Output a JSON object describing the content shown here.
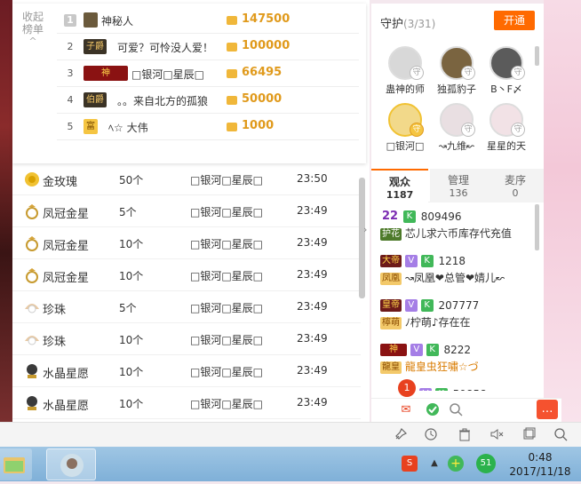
{
  "ranking": {
    "collapse_label": "收起榜单",
    "rows": [
      {
        "rank": "1",
        "badge": "",
        "name": "神秘人",
        "amount": "147500"
      },
      {
        "rank": "2",
        "badge": "子爵",
        "name": "可爱？可怜没人爱！",
        "amount": "100000"
      },
      {
        "rank": "3",
        "badge": "神",
        "name": "□银河□星辰□",
        "amount": "66495"
      },
      {
        "rank": "4",
        "badge": "伯爵",
        "name": "。。来自北方的孤狼",
        "amount": "50000"
      },
      {
        "rank": "5",
        "badge": "富",
        "name": "ﾍ☆ 大伟",
        "amount": "1000"
      }
    ]
  },
  "gifts": [
    {
      "name": "金玫瑰",
      "count": "50个",
      "sender": "□银河□星辰□",
      "time": "23:50"
    },
    {
      "name": "凤冠金星",
      "count": "5个",
      "sender": "□银河□星辰□",
      "time": "23:49"
    },
    {
      "name": "凤冠金星",
      "count": "10个",
      "sender": "□银河□星辰□",
      "time": "23:49"
    },
    {
      "name": "凤冠金星",
      "count": "10个",
      "sender": "□银河□星辰□",
      "time": "23:49"
    },
    {
      "name": "珍珠",
      "count": "5个",
      "sender": "□银河□星辰□",
      "time": "23:49"
    },
    {
      "name": "珍珠",
      "count": "10个",
      "sender": "□银河□星辰□",
      "time": "23:49"
    },
    {
      "name": "水晶星愿",
      "count": "10个",
      "sender": "□银河□星辰□",
      "time": "23:49"
    },
    {
      "name": "水晶星愿",
      "count": "10个",
      "sender": "□银河□星辰□",
      "time": "23:49"
    }
  ],
  "guard": {
    "title": "守护",
    "count": "(3/31)",
    "open_label": "开通",
    "members": [
      {
        "name": "蛊神的师"
      },
      {
        "name": "独孤豹子"
      },
      {
        "name": "B丶F〆"
      },
      {
        "name": "□银河□"
      },
      {
        "name": "↝九维↜"
      },
      {
        "name": "星星的天"
      }
    ]
  },
  "tabs": [
    {
      "label": "观众",
      "count": "1187"
    },
    {
      "label": "管理",
      "count": "136"
    },
    {
      "label": "麦序",
      "count": "0"
    }
  ],
  "audience": [
    {
      "level": "22",
      "badge": "护花",
      "id": "809496",
      "text": "芯儿求六币库存代充值"
    },
    {
      "level": "大帝",
      "badge": "凤凰",
      "id": "1218",
      "text": "↝凤凰❤总管❤婧儿↜"
    },
    {
      "level": "皇帝",
      "badge": "檸萌",
      "id": "207777",
      "text": "ﾉ柠萌♪存在在"
    },
    {
      "level": "神",
      "badge": "龍皇",
      "id": "8222",
      "text": "龍皇虫狂嘯☆づ"
    },
    {
      "level": "",
      "badge": "",
      "id": "59858",
      "text": ""
    }
  ],
  "notification_count": "1",
  "taskbar": {
    "time": "0:48",
    "date": "2017/11/18",
    "tray_badge": "51"
  },
  "colors": {
    "accent": "#ff6a00",
    "gold": "#e09a1c",
    "vip_purple": "#a57ee6",
    "k_green": "#41b859"
  }
}
